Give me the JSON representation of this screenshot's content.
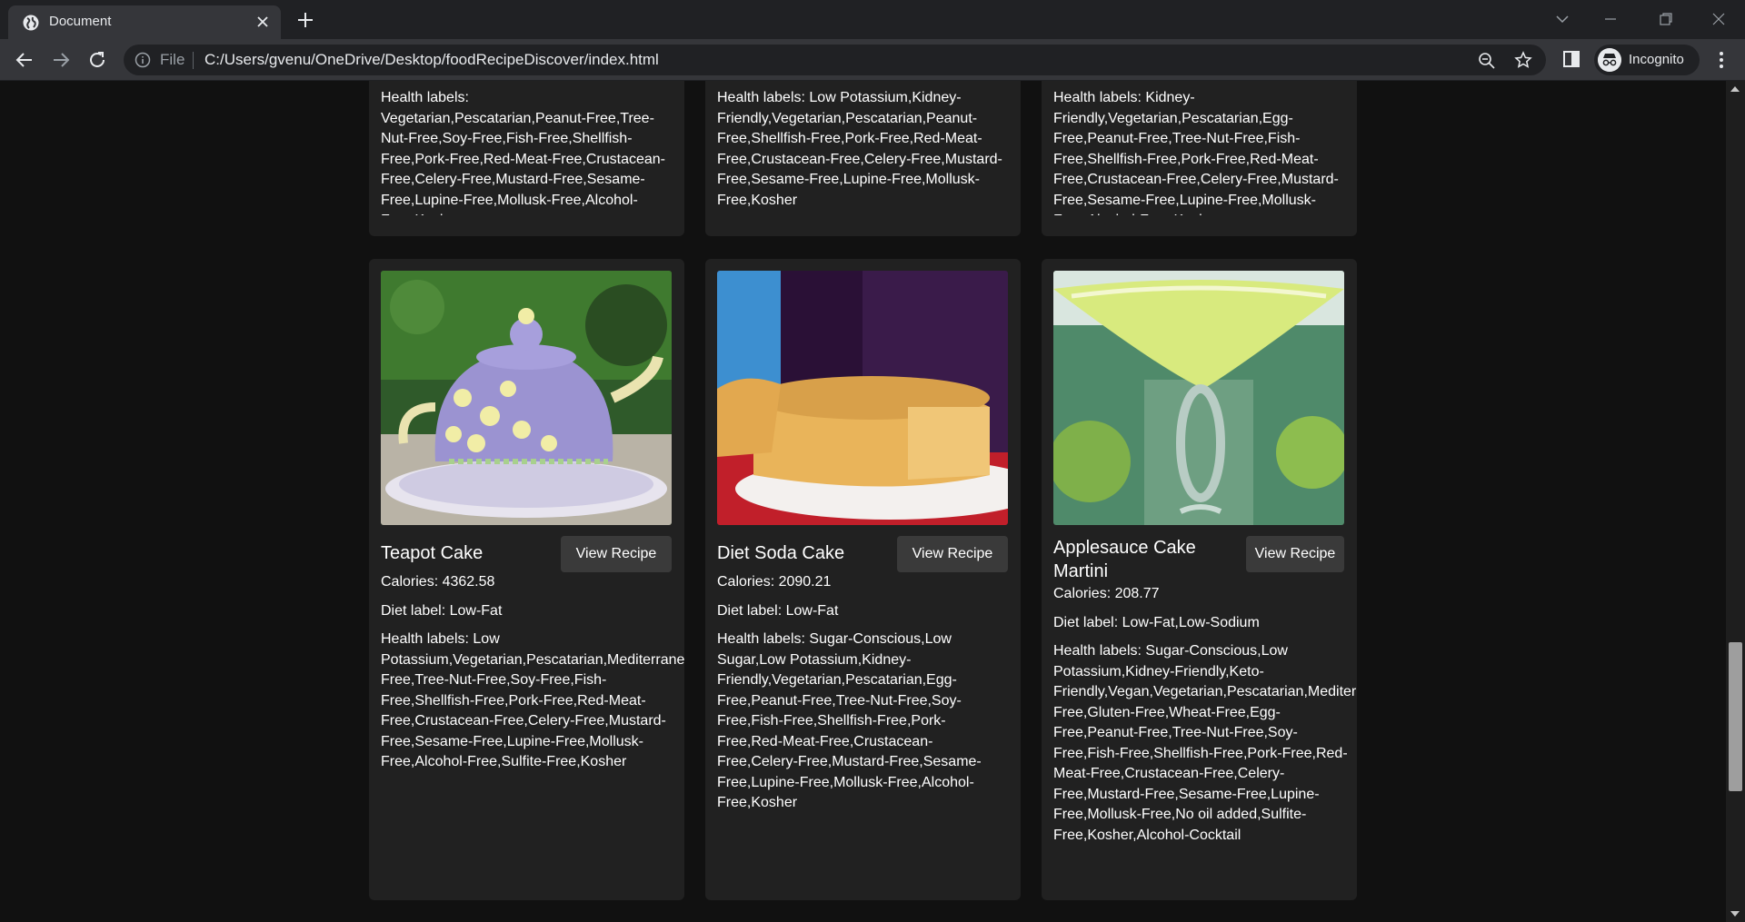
{
  "browser": {
    "tab_title": "Document",
    "omnibox_scheme": "File",
    "url": "C:/Users/gvenu/OneDrive/Desktop/foodRecipeDiscover/index.html",
    "profile_label": "Incognito"
  },
  "top_cards": [
    {
      "health_labels": "Health labels: Vegetarian,Pescatarian,Peanut-Free,Tree-Nut-Free,Soy-Free,Fish-Free,Shellfish-Free,Pork-Free,Red-Meat-Free,Crustacean-Free,Celery-Free,Mustard-Free,Sesame-Free,Lupine-Free,Mollusk-Free,Alcohol-Free,Kosher"
    },
    {
      "health_labels": "Health labels: Low Potassium,Kidney-Friendly,Vegetarian,Pescatarian,Peanut-Free,Shellfish-Free,Pork-Free,Red-Meat-Free,Crustacean-Free,Celery-Free,Mustard-Free,Sesame-Free,Lupine-Free,Mollusk-Free,Kosher"
    },
    {
      "health_labels": "Health labels: Kidney-Friendly,Vegetarian,Pescatarian,Egg-Free,Peanut-Free,Tree-Nut-Free,Fish-Free,Shellfish-Free,Pork-Free,Red-Meat-Free,Crustacean-Free,Celery-Free,Mustard-Free,Sesame-Free,Lupine-Free,Mollusk-Free,Alcohol-Free,Kosher"
    }
  ],
  "cards": [
    {
      "title": "Teapot Cake",
      "button": "View Recipe",
      "calories": "Calories: 4362.58",
      "diet": "Diet label: Low-Fat",
      "health_labels": "Health labels: Low Potassium,Vegetarian,Pescatarian,Mediterranean,Peanut-Free,Tree-Nut-Free,Soy-Free,Fish-Free,Shellfish-Free,Pork-Free,Red-Meat-Free,Crustacean-Free,Celery-Free,Mustard-Free,Sesame-Free,Lupine-Free,Mollusk-Free,Alcohol-Free,Sulfite-Free,Kosher"
    },
    {
      "title": "Diet Soda Cake",
      "button": "View Recipe",
      "calories": "Calories: 2090.21",
      "diet": "Diet label: Low-Fat",
      "health_labels": "Health labels: Sugar-Conscious,Low Sugar,Low Potassium,Kidney-Friendly,Vegetarian,Pescatarian,Egg-Free,Peanut-Free,Tree-Nut-Free,Soy-Free,Fish-Free,Shellfish-Free,Pork-Free,Red-Meat-Free,Crustacean-Free,Celery-Free,Mustard-Free,Sesame-Free,Lupine-Free,Mollusk-Free,Alcohol-Free,Kosher"
    },
    {
      "title": "Applesauce Cake Martini",
      "button": "View Recipe",
      "calories": "Calories: 208.77",
      "diet": "Diet label: Low-Fat,Low-Sodium",
      "health_labels": "Health labels: Sugar-Conscious,Low Potassium,Kidney-Friendly,Keto-Friendly,Vegan,Vegetarian,Pescatarian,Mediterranean,Dairy-Free,Gluten-Free,Wheat-Free,Egg-Free,Peanut-Free,Tree-Nut-Free,Soy-Free,Fish-Free,Shellfish-Free,Pork-Free,Red-Meat-Free,Crustacean-Free,Celery-Free,Mustard-Free,Sesame-Free,Lupine-Free,Mollusk-Free,No oil added,Sulfite-Free,Kosher,Alcohol-Cocktail"
    }
  ]
}
